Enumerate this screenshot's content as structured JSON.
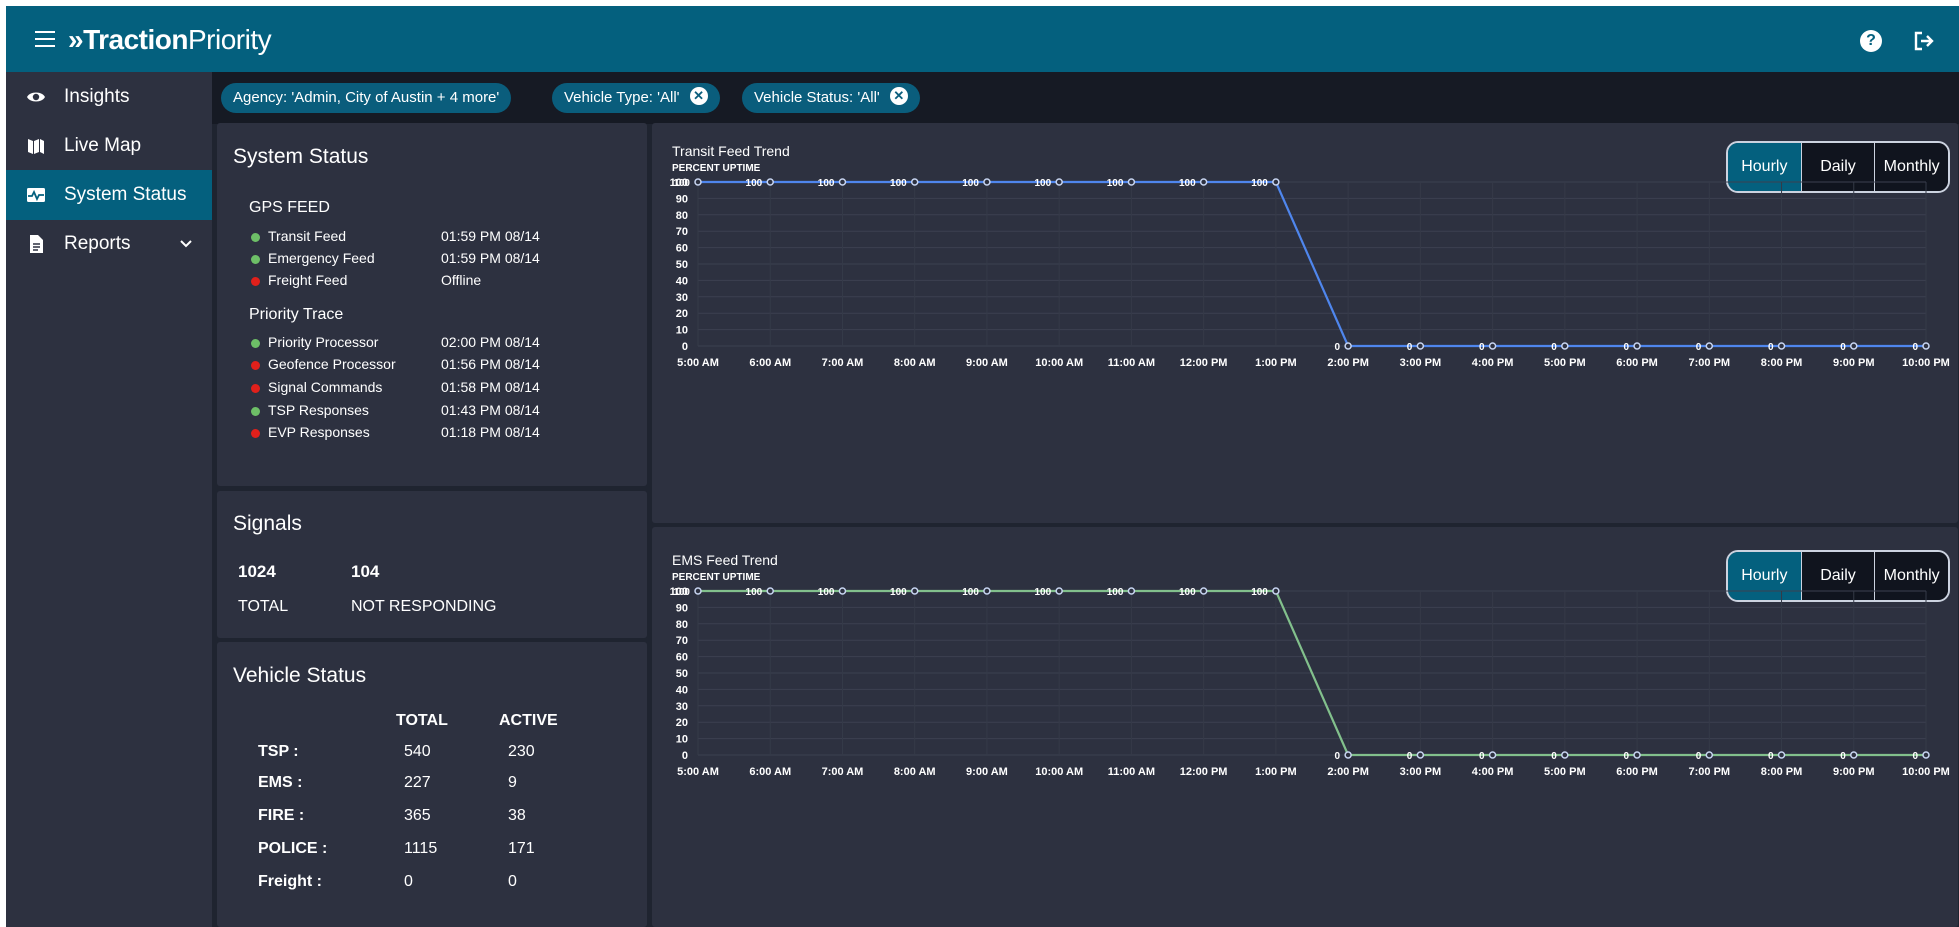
{
  "app": {
    "logo_bold": "»Traction",
    "logo_light": "Priority"
  },
  "sidebar": {
    "items": [
      {
        "label": "Insights",
        "icon": "eye-icon"
      },
      {
        "label": "Live Map",
        "icon": "map-icon"
      },
      {
        "label": "System Status",
        "icon": "pulse-icon"
      },
      {
        "label": "Reports",
        "icon": "document-icon"
      }
    ]
  },
  "filters": [
    {
      "label": "Agency: 'Admin, City of Austin + 4 more'"
    },
    {
      "label": "Vehicle Type: 'All'",
      "clear": "✕"
    },
    {
      "label": "Vehicle Status: 'All'",
      "clear": "✕"
    }
  ],
  "system_status": {
    "title": "System Status",
    "gps_title": "GPS FEED",
    "gps": [
      {
        "label": "Transit Feed",
        "time": "01:59 PM 08/14",
        "status": "ok"
      },
      {
        "label": "Emergency Feed",
        "time": "01:59 PM 08/14",
        "status": "ok"
      },
      {
        "label": "Freight Feed",
        "time": "Offline",
        "status": "error"
      }
    ],
    "trace_title": "Priority Trace",
    "trace": [
      {
        "label": "Priority Processor",
        "time": "02:00 PM 08/14",
        "status": "ok"
      },
      {
        "label": "Geofence Processor",
        "time": "01:56 PM 08/14",
        "status": "error"
      },
      {
        "label": "Signal Commands",
        "time": "01:58 PM 08/14",
        "status": "error"
      },
      {
        "label": "TSP Responses",
        "time": "01:43 PM 08/14",
        "status": "ok"
      },
      {
        "label": "EVP Responses",
        "time": "01:18 PM 08/14",
        "status": "error"
      }
    ]
  },
  "signals": {
    "title": "Signals",
    "total": "1024",
    "total_label": "TOTAL",
    "not_responding": "104",
    "not_responding_label": "NOT RESPONDING"
  },
  "vehicle_status": {
    "title": "Vehicle Status",
    "col_total": "TOTAL",
    "col_active": "ACTIVE",
    "rows": [
      {
        "label": "TSP :",
        "total": "540",
        "active": "230"
      },
      {
        "label": "EMS :",
        "total": "227",
        "active": "9"
      },
      {
        "label": "FIRE :",
        "total": "365",
        "active": "38"
      },
      {
        "label": "POLICE :",
        "total": "1115",
        "active": "171"
      },
      {
        "label": "Freight :",
        "total": "0",
        "active": "0"
      }
    ]
  },
  "toggle": {
    "options": [
      "Hourly",
      "Daily",
      "Monthly"
    ],
    "selected": "Hourly"
  },
  "colors": {
    "ok": "#6dbf67",
    "error": "#e0201b",
    "accent": "#04607e",
    "transit_line": "#4f86ed",
    "ems_line": "#82c08c"
  },
  "chart_data": [
    {
      "type": "line",
      "title": "Transit Feed Trend",
      "subtitle": "PERCENT UPTIME",
      "categories": [
        "5:00 AM",
        "6:00 AM",
        "7:00 AM",
        "8:00 AM",
        "9:00 AM",
        "10:00 AM",
        "11:00 AM",
        "12:00 PM",
        "1:00 PM",
        "2:00 PM",
        "3:00 PM",
        "4:00 PM",
        "5:00 PM",
        "6:00 PM",
        "7:00 PM",
        "8:00 PM",
        "9:00 PM",
        "10:00 PM"
      ],
      "values": [
        100,
        100,
        100,
        100,
        100,
        100,
        100,
        100,
        100,
        0,
        0,
        0,
        0,
        0,
        0,
        0,
        0,
        0
      ],
      "yticks": [
        "0",
        "10",
        "20",
        "30",
        "40",
        "50",
        "60",
        "70",
        "80",
        "90",
        "100"
      ],
      "ylim": [
        0,
        100
      ],
      "grid": true
    },
    {
      "type": "line",
      "title": "EMS Feed Trend",
      "subtitle": "PERCENT UPTIME",
      "categories": [
        "5:00 AM",
        "6:00 AM",
        "7:00 AM",
        "8:00 AM",
        "9:00 AM",
        "10:00 AM",
        "11:00 AM",
        "12:00 PM",
        "1:00 PM",
        "2:00 PM",
        "3:00 PM",
        "4:00 PM",
        "5:00 PM",
        "6:00 PM",
        "7:00 PM",
        "8:00 PM",
        "9:00 PM",
        "10:00 PM"
      ],
      "values": [
        100,
        100,
        100,
        100,
        100,
        100,
        100,
        100,
        100,
        0,
        0,
        0,
        0,
        0,
        0,
        0,
        0,
        0
      ],
      "yticks": [
        "0",
        "10",
        "20",
        "30",
        "40",
        "50",
        "60",
        "70",
        "80",
        "90",
        "100"
      ],
      "ylim": [
        0,
        100
      ],
      "grid": true
    }
  ]
}
